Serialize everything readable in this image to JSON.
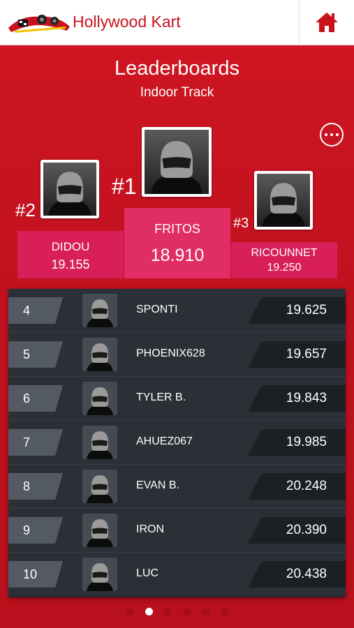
{
  "header": {
    "app_title": "Hollywood Kart",
    "logo_text": "HOLLYWOOD KART",
    "home_icon": "home-icon"
  },
  "page": {
    "title": "Leaderboards",
    "subtitle": "Indoor Track",
    "more_icon": "more-options-icon"
  },
  "podium": {
    "first": {
      "rank": "#1",
      "name": "FRITOS",
      "time": "18.910"
    },
    "second": {
      "rank": "#2",
      "name": "DIDOU",
      "time": "19.155"
    },
    "third": {
      "rank": "#3",
      "name": "RICOUNNET",
      "time": "19.250"
    }
  },
  "leaderboard": [
    {
      "pos": "4",
      "name": "SPONTI",
      "time": "19.625"
    },
    {
      "pos": "5",
      "name": "PHOENIX628",
      "time": "19.657"
    },
    {
      "pos": "6",
      "name": "TYLER B.",
      "time": "19.843"
    },
    {
      "pos": "7",
      "name": "AHUEZ067",
      "time": "19.985"
    },
    {
      "pos": "8",
      "name": "EVAN B.",
      "time": "20.248"
    },
    {
      "pos": "9",
      "name": "IRON",
      "time": "20.390"
    },
    {
      "pos": "10",
      "name": "LUC",
      "time": "20.438"
    }
  ],
  "pagination": {
    "total": 6,
    "active_index": 1
  },
  "colors": {
    "brand_red": "#c8131f",
    "podium_pink": "#d81f5a",
    "podium_pink_center": "#e12d66",
    "table_dark": "#2b3037"
  }
}
